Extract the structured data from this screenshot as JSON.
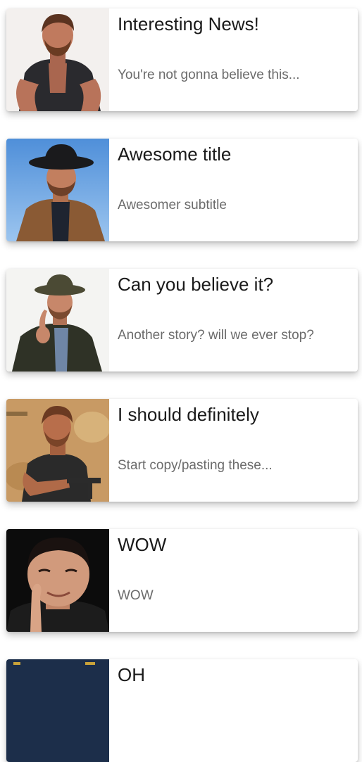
{
  "cards": [
    {
      "image": "man-in-vest-photo",
      "title": "Interesting News!",
      "subtitle": "You're not gonna believe this..."
    },
    {
      "image": "man-in-cowboy-hat-photo",
      "title": "Awesome title",
      "subtitle": "Awesomer subtitle"
    },
    {
      "image": "man-in-hat-and-coat-pointing-photo",
      "title": "Can you believe it?",
      "subtitle": "Another story? will we ever stop?"
    },
    {
      "image": "man-holding-gun-photo",
      "title": "I should definitely",
      "subtitle": "Start copy/pasting these..."
    },
    {
      "image": "man-winking-photo",
      "title": "WOW",
      "subtitle": "WOW"
    },
    {
      "image": "photo",
      "title": "OH",
      "subtitle": ""
    }
  ]
}
